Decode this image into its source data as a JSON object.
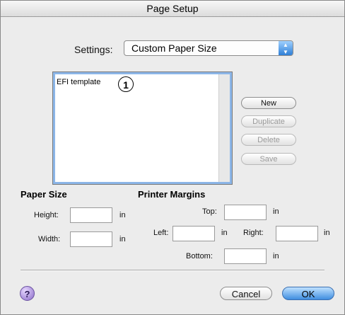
{
  "window": {
    "title": "Page Setup"
  },
  "settings": {
    "label": "Settings:",
    "value": "Custom Paper Size"
  },
  "list": {
    "items": [
      "EFI template"
    ],
    "callout": "1"
  },
  "buttons": {
    "new": "New",
    "duplicate": "Duplicate",
    "delete": "Delete",
    "save": "Save"
  },
  "paper_size": {
    "heading": "Paper Size",
    "height_label": "Height:",
    "height_value": "",
    "width_label": "Width:",
    "width_value": "",
    "unit": "in"
  },
  "printer_margins": {
    "heading": "Printer Margins",
    "top_label": "Top:",
    "top_value": "",
    "left_label": "Left:",
    "left_value": "",
    "right_label": "Right:",
    "right_value": "",
    "bottom_label": "Bottom:",
    "bottom_value": "",
    "unit": "in"
  },
  "footer": {
    "help": "?",
    "cancel": "Cancel",
    "ok": "OK"
  }
}
